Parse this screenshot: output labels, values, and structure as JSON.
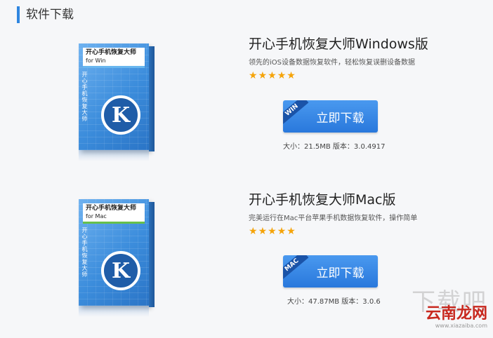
{
  "section": {
    "title": "软件下载"
  },
  "products": [
    {
      "box_title": "开心手机恢复大师",
      "box_sub": "for Win",
      "box_vertical": "开心手机恢复大师",
      "logo_letter": "K",
      "title": "开心手机恢复大师Windows版",
      "desc": "领先的iOS设备数据恢复软件，轻松恢复误删设备数据",
      "rating": "5",
      "stars": [
        "★",
        "★",
        "★",
        "★",
        "★"
      ],
      "download_label": "立即下载",
      "platform_badge": "WIN",
      "meta": "大小：21.5MB 版本：3.0.4917"
    },
    {
      "box_title": "开心手机恢复大师",
      "box_sub": "for Mac",
      "box_vertical": "开心手机恢复大师",
      "logo_letter": "K",
      "title": "开心手机恢复大师Mac版",
      "desc": "完美运行在Mac平台苹果手机数据恢复软件，操作简单",
      "rating": "5",
      "stars": [
        "★",
        "★",
        "★",
        "★",
        "★"
      ],
      "download_label": "立即下载",
      "platform_badge": "MAC",
      "meta": "大小：47.87MB 版本：3.0.6"
    }
  ],
  "watermark": {
    "big": "下载吧",
    "brand": "云南龙网",
    "url": "www.xiazaiba.com"
  },
  "colors": {
    "accent": "#2f86e0",
    "button": "#2978dc",
    "star": "#f5a40a",
    "win_stripe": "#69b7ef",
    "mac_stripe": "#66c04a"
  }
}
